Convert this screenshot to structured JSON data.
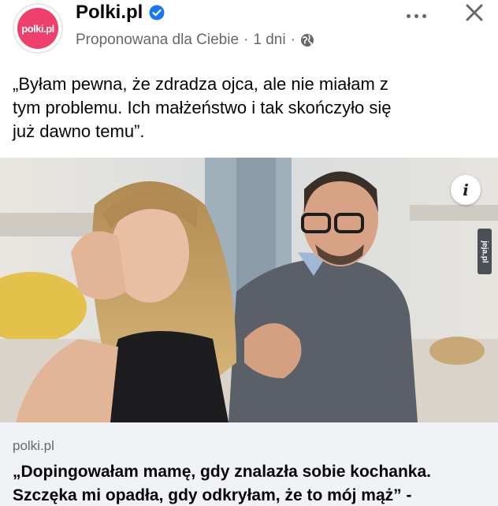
{
  "post": {
    "page_name": "Polki.pl",
    "avatar_text": "polki.pl",
    "meta": {
      "suggested": "Proponowana dla Ciebie",
      "separator": "·",
      "time": "1 dni",
      "separator2": "·"
    },
    "text_line1": "„Byłam pewna, że zdradza ojca, ale nie miałam z",
    "text_line2": "tym problemu. Ich małżeństwo i tak skończyło się",
    "text_line3": "już dawno temu”."
  },
  "image": {
    "info_label": "i",
    "watermark": "jeja.pl"
  },
  "link": {
    "domain": "polki.pl",
    "title_line1": "„Dopingowałam mamę, gdy znalazła sobie kochanka.",
    "title_line2": "Szczęka mi opadła, gdy odkryłam, że to mój mąż” -"
  },
  "colors": {
    "brand": "#ef3f6b",
    "verified": "#1877f2",
    "secondary_text": "#65676b",
    "card_bg": "#f0f2f5"
  },
  "icons": [
    "verified-badge-icon",
    "globe-icon",
    "more-icon",
    "close-icon",
    "info-icon"
  ]
}
